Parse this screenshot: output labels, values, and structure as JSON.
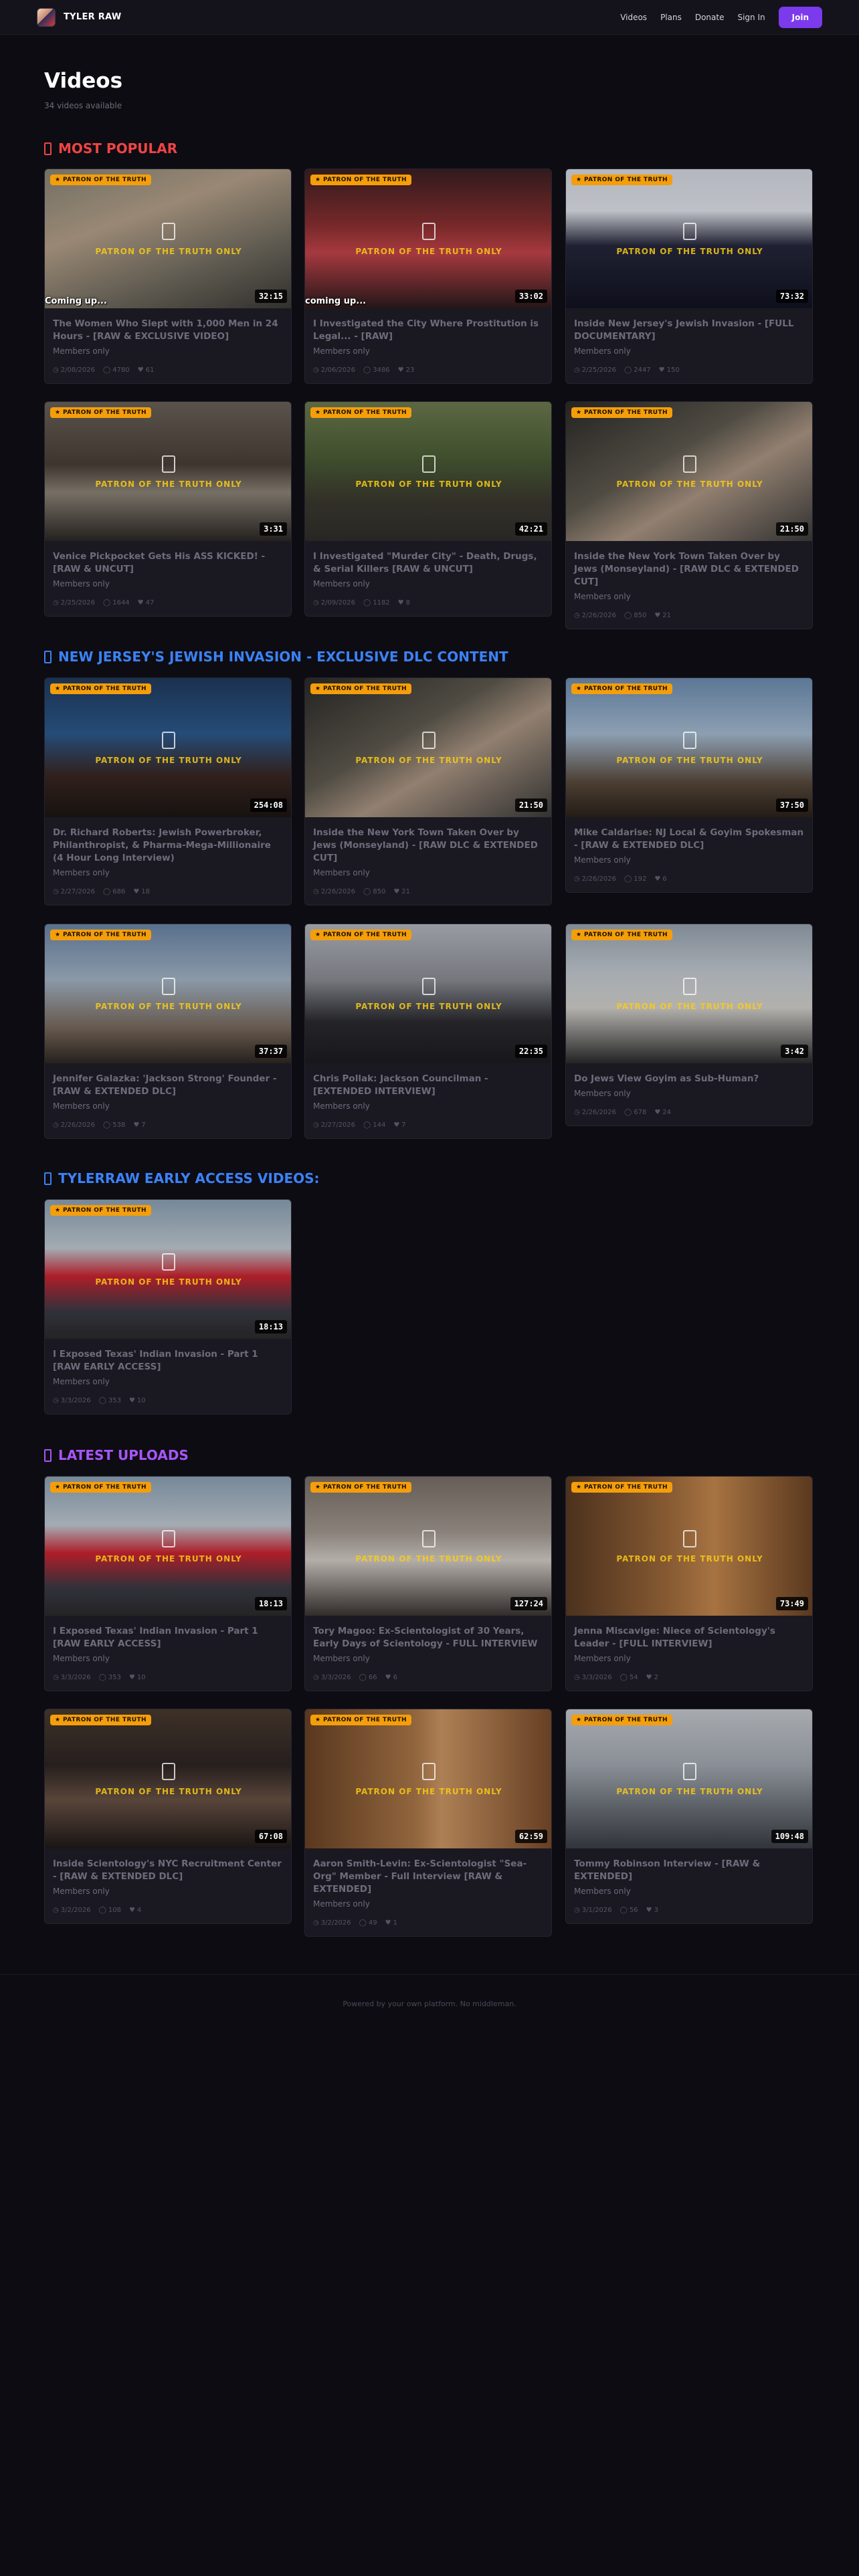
{
  "nav": {
    "brand": "TYLER RAW",
    "links": [
      "Videos",
      "Plans",
      "Donate",
      "Sign In"
    ],
    "join": "Join"
  },
  "header": {
    "title": "Videos",
    "subtitle": "34 videos available"
  },
  "badge_text": "★ PATRON OF THE TRUTH",
  "watermark_text": "PATRON OF THE TRUTH ONLY",
  "members_text": "Members only",
  "footer": "Powered by your own platform. No middleman.",
  "sections": [
    {
      "title": "MOST POPULAR",
      "color": "red",
      "videos": [
        {
          "title": "The Women Who Slept with 1,000 Men in 24 Hours - [RAW & EXCLUSIVE VIDEO]",
          "duration": "32:15",
          "date": "2/08/2026",
          "views": "4780",
          "likes": "61",
          "caption": "Coming up..."
        },
        {
          "title": "I Investigated the City Where Prostitution is Legal... - [RAW]",
          "duration": "33:02",
          "date": "2/06/2026",
          "views": "3486",
          "likes": "23",
          "caption": "coming up..."
        },
        {
          "title": "Inside New Jersey's Jewish Invasion - [FULL DOCUMENTARY]",
          "duration": "73:32",
          "date": "2/25/2026",
          "views": "2447",
          "likes": "150",
          "caption": ""
        },
        {
          "title": "Venice Pickpocket Gets His ASS KICKED! - [RAW & UNCUT]",
          "duration": "3:31",
          "date": "2/25/2026",
          "views": "1644",
          "likes": "47",
          "caption": ""
        },
        {
          "title": "I Investigated \"Murder City\" - Death, Drugs, & Serial Killers [RAW & UNCUT]",
          "duration": "42:21",
          "date": "2/09/2026",
          "views": "1182",
          "likes": "8",
          "caption": ""
        },
        {
          "title": "Inside the New York Town Taken Over by Jews (Monseyland) - [RAW DLC & EXTENDED CUT]",
          "duration": "21:50",
          "date": "2/26/2026",
          "views": "850",
          "likes": "21",
          "caption": ""
        }
      ]
    },
    {
      "title": "NEW JERSEY'S JEWISH INVASION - EXCLUSIVE DLC CONTENT",
      "color": "blue",
      "videos": [
        {
          "title": "Dr. Richard Roberts: Jewish Powerbroker, Philanthropist, & Pharma-Mega-Millionaire (4 Hour Long Interview)",
          "duration": "254:08",
          "date": "2/27/2026",
          "views": "686",
          "likes": "18",
          "caption": ""
        },
        {
          "title": "Inside the New York Town Taken Over by Jews (Monseyland) - [RAW DLC & EXTENDED CUT]",
          "duration": "21:50",
          "date": "2/26/2026",
          "views": "850",
          "likes": "21",
          "caption": ""
        },
        {
          "title": "Mike Caldarise: NJ Local & Goyim Spokesman - [RAW & EXTENDED DLC]",
          "duration": "37:50",
          "date": "2/26/2026",
          "views": "192",
          "likes": "6",
          "caption": ""
        },
        {
          "title": "Jennifer Galazka: 'Jackson Strong' Founder - [RAW & EXTENDED DLC]",
          "duration": "37:37",
          "date": "2/26/2026",
          "views": "538",
          "likes": "7",
          "caption": ""
        },
        {
          "title": "Chris Pollak: Jackson Councilman - [EXTENDED INTERVIEW]",
          "duration": "22:35",
          "date": "2/27/2026",
          "views": "144",
          "likes": "7",
          "caption": ""
        },
        {
          "title": "Do Jews View Goyim as Sub-Human?",
          "duration": "3:42",
          "date": "2/26/2026",
          "views": "678",
          "likes": "24",
          "caption": ""
        }
      ]
    },
    {
      "title": "TYLERRAW EARLY ACCESS VIDEOS:",
      "color": "blue",
      "videos": [
        {
          "title": "I Exposed Texas' Indian Invasion - Part 1 [RAW EARLY ACCESS]",
          "duration": "18:13",
          "date": "3/3/2026",
          "views": "353",
          "likes": "10",
          "caption": ""
        }
      ]
    },
    {
      "title": "LATEST UPLOADS",
      "color": "purple",
      "videos": [
        {
          "title": "I Exposed Texas' Indian Invasion - Part 1 [RAW EARLY ACCESS]",
          "duration": "18:13",
          "date": "3/3/2026",
          "views": "353",
          "likes": "10",
          "caption": ""
        },
        {
          "title": "Tory Magoo: Ex-Scientologist of 30 Years, Early Days of Scientology - FULL INTERVIEW",
          "duration": "127:24",
          "date": "3/3/2026",
          "views": "66",
          "likes": "6",
          "caption": ""
        },
        {
          "title": "Jenna Miscavige: Niece of Scientology's Leader - [FULL INTERVIEW]",
          "duration": "73:49",
          "date": "3/3/2026",
          "views": "54",
          "likes": "2",
          "caption": ""
        },
        {
          "title": "Inside Scientology's NYC Recruitment Center - [RAW & EXTENDED DLC]",
          "duration": "67:08",
          "date": "3/2/2026",
          "views": "108",
          "likes": "4",
          "caption": ""
        },
        {
          "title": "Aaron Smith-Levin: Ex-Scientologist \"Sea-Org\" Member - Full Interview [RAW & EXTENDED]",
          "duration": "62:59",
          "date": "3/2/2026",
          "views": "49",
          "likes": "1",
          "caption": ""
        },
        {
          "title": "Tommy Robinson Interview - [RAW & EXTENDED]",
          "duration": "109:48",
          "date": "3/1/2026",
          "views": "56",
          "likes": "3",
          "caption": ""
        }
      ]
    }
  ]
}
